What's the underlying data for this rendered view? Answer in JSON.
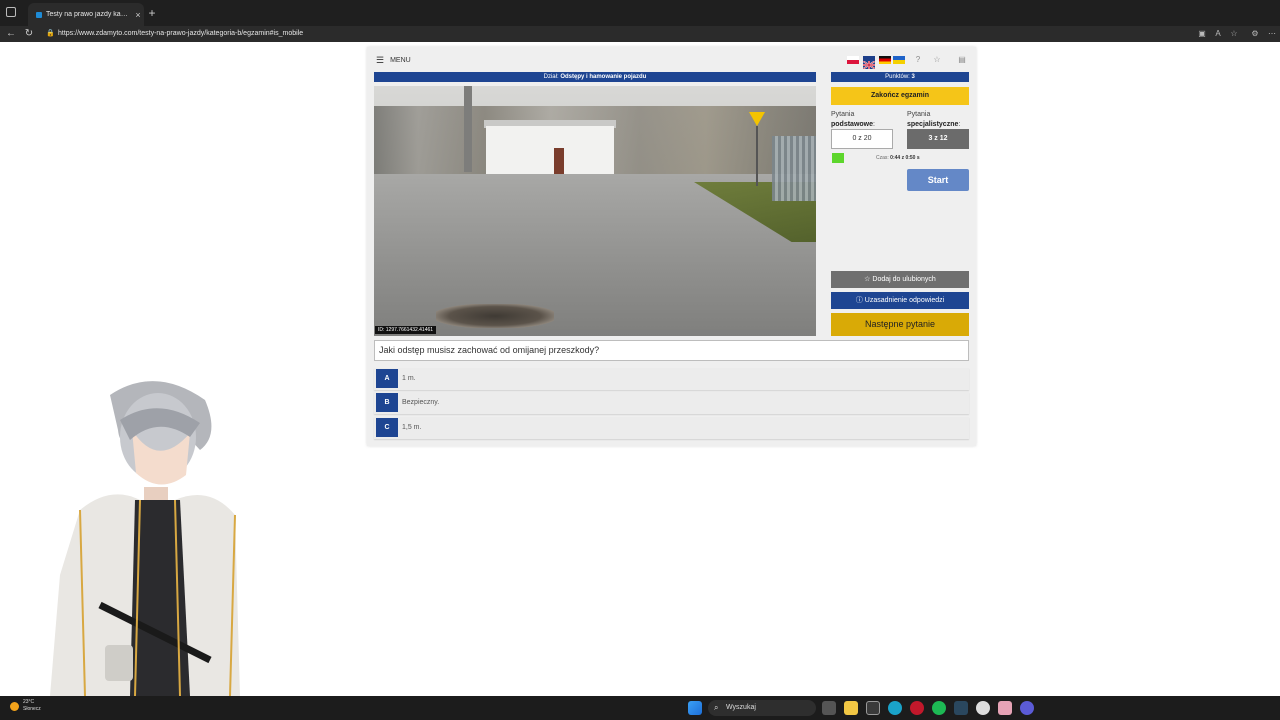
{
  "browser": {
    "tab_title": "Testy na prawo jazdy kategoria B",
    "tab_close": "×",
    "new_tab": "+",
    "url": "https://www.zdamyto.com/testy-na-prawo-jazdy/kategoria-b/egzamin#is_mobile"
  },
  "header": {
    "menu_label": "MENU",
    "dzial_prefix": "Dział:",
    "dzial_value": "Odstępy i hamowanie pojazdu",
    "punkty_prefix": "Punktów:",
    "punkty_value": "3"
  },
  "photo": {
    "image_id": "ID: 1297.7661432.41461"
  },
  "panel": {
    "end_exam": "Zakończ egzamin",
    "basic_label_1": "Pytania",
    "basic_label_2": "podstawowe",
    "special_label_1": "Pytania",
    "special_label_2": "specjalistyczne",
    "basic_count": "0 z 20",
    "special_count": "3 z 12",
    "time_label": "Czas:",
    "time_value": "0:44 z 0:50 s",
    "time_progress": 0.09,
    "start": "Start",
    "add_favorite": "Dodaj do ulubionych",
    "justification": "Uzasadnienie odpowiedzi",
    "next_question": "Następne pytanie"
  },
  "question": {
    "text": "Jaki odstęp musisz zachować od omijanej przeszkody?",
    "answers": [
      {
        "key": "A",
        "text": "1 m."
      },
      {
        "key": "B",
        "text": "Bezpieczny."
      },
      {
        "key": "C",
        "text": "1,5 m."
      }
    ]
  },
  "taskbar": {
    "temperature": "23°C",
    "weather": "Słonecz",
    "search_placeholder": "Wyszukaj"
  },
  "colors": {
    "primary_blue": "#1e4592",
    "yellow": "#f5c518",
    "gold": "#d9aa06",
    "start_blue": "#6488c7"
  }
}
